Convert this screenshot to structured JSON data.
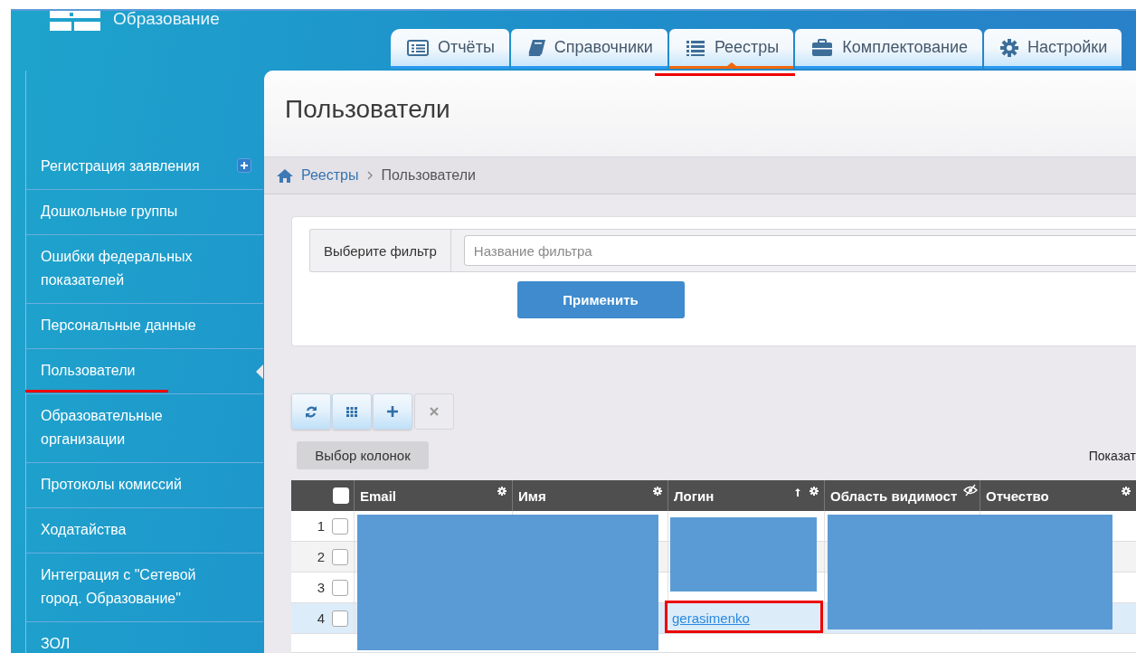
{
  "header": {
    "logo_text": "Образование"
  },
  "tabs": [
    {
      "label": "Отчёты",
      "selected": false,
      "annotated": false
    },
    {
      "label": "Справочники",
      "selected": false,
      "annotated": false
    },
    {
      "label": "Реестры",
      "selected": true,
      "annotated": true
    },
    {
      "label": "Комплектование",
      "selected": false,
      "annotated": false
    },
    {
      "label": "Настройки",
      "selected": false,
      "annotated": false
    }
  ],
  "sidebar": {
    "items": [
      {
        "label": "Регистрация заявления",
        "kind": "with-add",
        "selected": false,
        "annotated": false
      },
      {
        "label": "Дошкольные группы",
        "kind": "plain",
        "selected": false,
        "annotated": false
      },
      {
        "label": "Ошибки федеральных показателей",
        "kind": "plain",
        "selected": false,
        "annotated": false
      },
      {
        "label": "Персональные данные",
        "kind": "plain",
        "selected": false,
        "annotated": false
      },
      {
        "label": "Пользователи",
        "kind": "plain",
        "selected": true,
        "annotated": true
      },
      {
        "label": "Образовательные организации",
        "kind": "plain",
        "selected": false,
        "annotated": false
      },
      {
        "label": "Протоколы комиссий",
        "kind": "plain",
        "selected": false,
        "annotated": false
      },
      {
        "label": "Ходатайства",
        "kind": "plain",
        "selected": false,
        "annotated": false
      },
      {
        "label": "Интеграция с \"Сетевой город. Образование\"",
        "kind": "plain",
        "selected": false,
        "annotated": false
      },
      {
        "label": "ЗОЛ",
        "kind": "plain",
        "selected": false,
        "annotated": false
      }
    ]
  },
  "page_title": "Пользователи",
  "breadcrumb": [
    {
      "label": "Реестры",
      "kind": "link"
    },
    {
      "label": "Пользователи",
      "kind": "current"
    }
  ],
  "filter": {
    "label": "Выберите фильтр",
    "placeholder": "Название фильтра",
    "apply_button": "Применить"
  },
  "toolbar": [
    {
      "kind": "refresh",
      "disabled": false
    },
    {
      "kind": "columns",
      "disabled": false
    },
    {
      "kind": "add",
      "disabled": false
    },
    {
      "kind": "delete",
      "disabled": true
    }
  ],
  "columns_button": "Выбор колонок",
  "show_label": "Показат",
  "table": {
    "redacted": true,
    "header_checked": false,
    "columns": [
      {
        "label": "Email",
        "sorted": false,
        "hidden": false
      },
      {
        "label": "Имя",
        "sorted": false,
        "hidden": false
      },
      {
        "label": "Логин",
        "sorted": true,
        "hidden": false
      },
      {
        "label": "Область видимост",
        "sorted": false,
        "hidden": true
      },
      {
        "label": "Отчество",
        "sorted": false,
        "hidden": false
      }
    ],
    "rows": [
      {
        "number": "1",
        "checked": false,
        "selected": false,
        "login": null,
        "annotated": false
      },
      {
        "number": "2",
        "checked": false,
        "selected": false,
        "login": null,
        "annotated": false
      },
      {
        "number": "3",
        "checked": false,
        "selected": false,
        "login": null,
        "annotated": false
      },
      {
        "number": "4",
        "checked": false,
        "selected": true,
        "login": "gerasimenko",
        "annotated": true
      }
    ]
  }
}
